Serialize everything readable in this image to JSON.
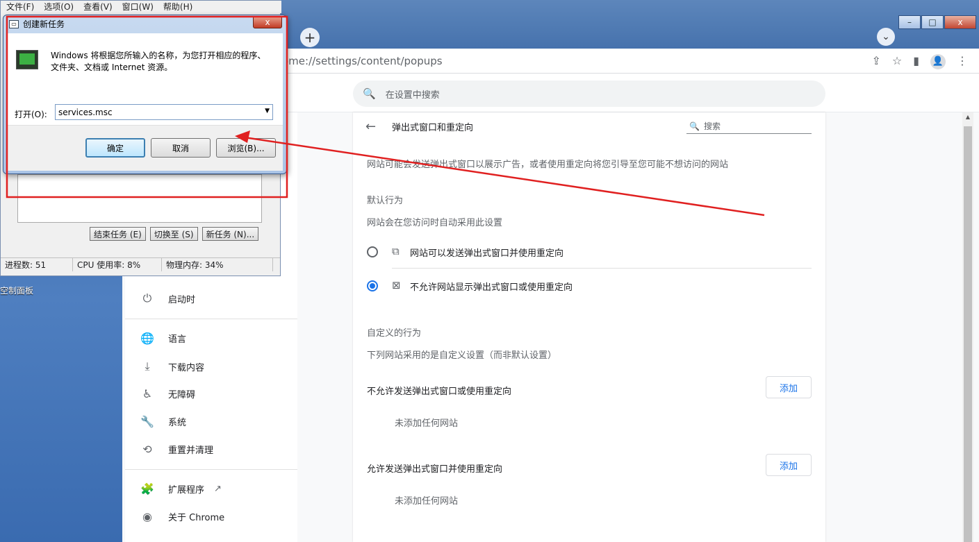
{
  "desktop": {
    "label": "空制面板"
  },
  "taskmgr": {
    "menu": [
      "文件(F)",
      "选项(O)",
      "查看(V)",
      "窗口(W)",
      "帮助(H)"
    ],
    "buttons": {
      "end_task": "结束任务 (E)",
      "switch_to": "切换至 (S)",
      "new_task": "新任务 (N)..."
    },
    "status": {
      "processes": "进程数: 51",
      "cpu": "CPU 使用率: 8%",
      "memory": "物理内存: 34%"
    }
  },
  "run_dialog": {
    "title": "创建新任务",
    "close_label": "x",
    "description": "Windows 将根据您所输入的名称，为您打开相应的程序、文件夹、文档或 Internet 资源。",
    "open_label": "打开(O):",
    "open_value": "services.msc",
    "ok": "确定",
    "cancel": "取消",
    "browse": "浏览(B)..."
  },
  "chrome": {
    "url": "ome://settings/content/popups",
    "new_tab": "+",
    "search_placeholder": "在设置中搜索",
    "window_buttons": {
      "minimize": "–",
      "maximize": "□",
      "close": "x"
    }
  },
  "sidebar": {
    "items": [
      {
        "label": "启动时",
        "icon": "power-icon"
      },
      {
        "label": "语言",
        "icon": "globe-icon"
      },
      {
        "label": "下载内容",
        "icon": "download-icon"
      },
      {
        "label": "无障碍",
        "icon": "accessibility-icon"
      },
      {
        "label": "系统",
        "icon": "wrench-icon"
      },
      {
        "label": "重置并清理",
        "icon": "history-icon"
      },
      {
        "label": "扩展程序",
        "icon": "puzzle-icon"
      },
      {
        "label": "关于 Chrome",
        "icon": "chrome-icon"
      }
    ]
  },
  "panel": {
    "title": "弹出式窗口和重定向",
    "search_placeholder": "搜索",
    "description": "网站可能会发送弹出式窗口以展示广告，或者使用重定向将您引导至您可能不想访问的网站",
    "default_behavior": {
      "heading": "默认行为",
      "sub": "网站会在您访问时自动采用此设置",
      "options": [
        {
          "label": "网站可以发送弹出式窗口并使用重定向",
          "selected": false
        },
        {
          "label": "不允许网站显示弹出式窗口或使用重定向",
          "selected": true
        }
      ]
    },
    "custom_behavior": {
      "heading": "自定义的行为",
      "sub": "下列网站采用的是自定义设置（而非默认设置）",
      "lists": [
        {
          "title": "不允许发送弹出式窗口或使用重定向",
          "add": "添加",
          "empty": "未添加任何网站"
        },
        {
          "title": "允许发送弹出式窗口并使用重定向",
          "add": "添加",
          "empty": "未添加任何网站"
        }
      ]
    }
  },
  "colors": {
    "accent": "#1a73e8",
    "annotation": "#e02020"
  }
}
